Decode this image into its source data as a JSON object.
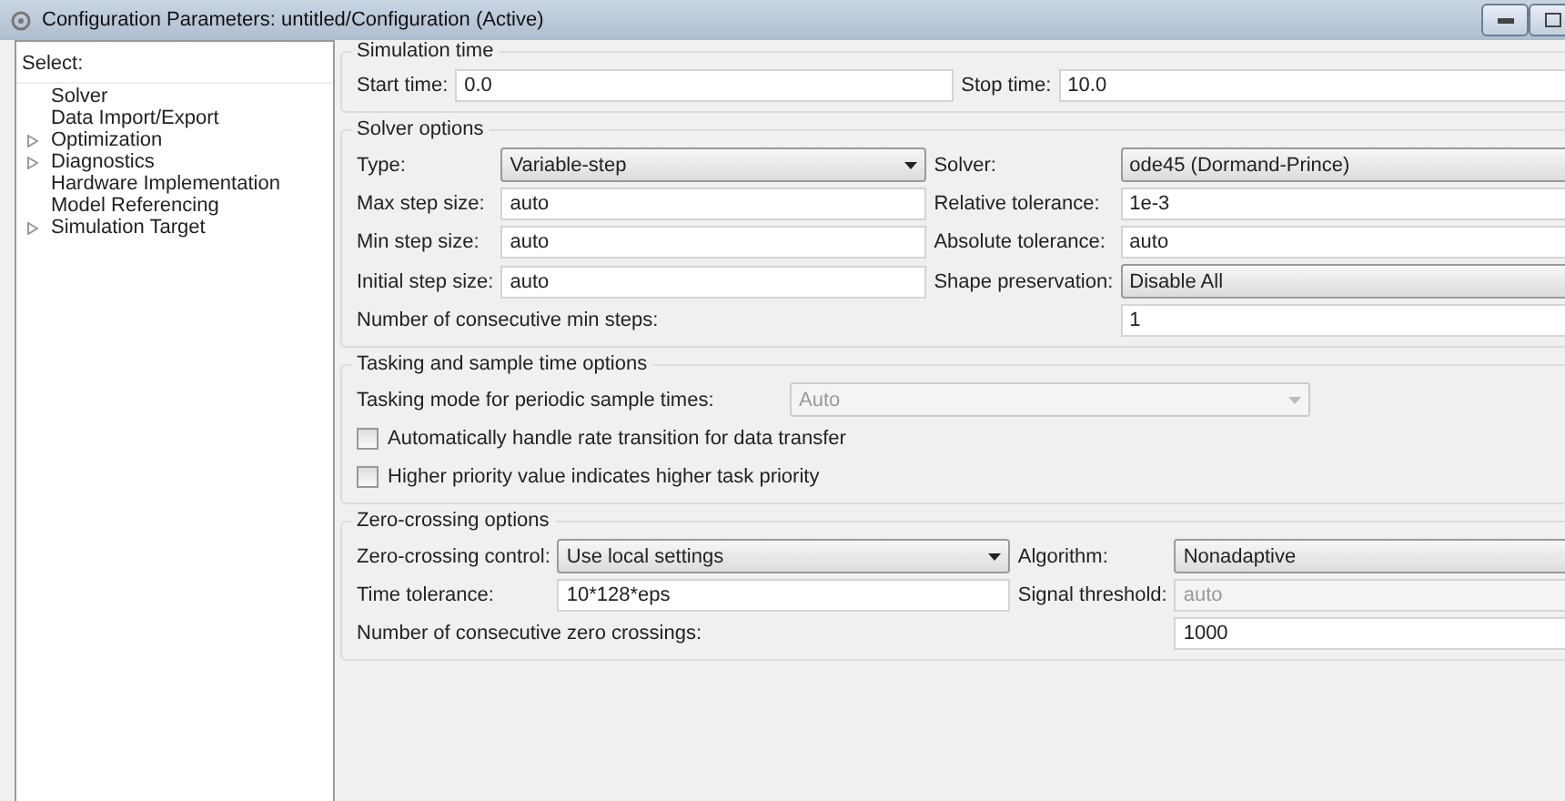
{
  "window": {
    "title": "Configuration Parameters: untitled/Configuration (Active)"
  },
  "sidebar": {
    "header": "Select:",
    "items": [
      {
        "label": "Solver",
        "kind": "leaf"
      },
      {
        "label": "Data Import/Export",
        "kind": "leaf"
      },
      {
        "label": "Optimization",
        "kind": "group",
        "expanded": false
      },
      {
        "label": "Diagnostics",
        "kind": "group",
        "expanded": false
      },
      {
        "label": "Hardware Implementation",
        "kind": "leaf"
      },
      {
        "label": "Model Referencing",
        "kind": "leaf"
      },
      {
        "label": "Simulation Target",
        "kind": "group",
        "expanded": false
      }
    ]
  },
  "sections": [
    {
      "title": "Simulation time",
      "kind": "time",
      "rows": [
        {
          "kind": "pair",
          "fields": [
            {
              "label": "Start time:",
              "kind": "text",
              "value": "0.0",
              "disabled": false
            },
            {
              "label": "Stop time:",
              "kind": "text",
              "value": "10.0",
              "disabled": false
            }
          ]
        }
      ]
    },
    {
      "title": "Solver options",
      "kind": "solver",
      "rows": [
        {
          "kind": "pair",
          "fields": [
            {
              "label": "Type:",
              "kind": "dropdown",
              "value": "Variable-step",
              "disabled": false
            },
            {
              "label": "Solver:",
              "kind": "dropdown",
              "value": "ode45 (Dormand-Prince)",
              "disabled": false
            }
          ]
        },
        {
          "kind": "pair",
          "fields": [
            {
              "label": "Max step size:",
              "kind": "text",
              "value": "auto",
              "disabled": false
            },
            {
              "label": "Relative tolerance:",
              "kind": "text",
              "value": "1e-3",
              "disabled": false
            }
          ]
        },
        {
          "kind": "pair",
          "fields": [
            {
              "label": "Min step size:",
              "kind": "text",
              "value": "auto",
              "disabled": false
            },
            {
              "label": "Absolute tolerance:",
              "kind": "text",
              "value": "auto",
              "disabled": false
            }
          ]
        },
        {
          "kind": "pair",
          "fields": [
            {
              "label": "Initial step size:",
              "kind": "text",
              "value": "auto",
              "disabled": false
            },
            {
              "label": "Shape preservation:",
              "kind": "dropdown",
              "value": "Disable All",
              "disabled": false
            }
          ]
        },
        {
          "kind": "single",
          "fields": [
            {
              "label": "Number of consecutive min steps:",
              "kind": "text",
              "value": "1",
              "disabled": false
            }
          ]
        }
      ]
    },
    {
      "title": "Tasking and sample time options",
      "kind": "tasking",
      "rows": [
        {
          "kind": "single",
          "fields": [
            {
              "label": "Tasking mode for periodic sample times:",
              "kind": "dropdown",
              "value": "Auto",
              "disabled": true
            }
          ]
        },
        {
          "kind": "checkbox",
          "label": "Automatically handle rate transition for data transfer",
          "checked": false
        },
        {
          "kind": "checkbox",
          "label": "Higher priority value indicates higher task priority",
          "checked": false
        }
      ]
    },
    {
      "title": "Zero-crossing options",
      "kind": "zero",
      "rows": [
        {
          "kind": "pair",
          "fields": [
            {
              "label": "Zero-crossing control:",
              "kind": "dropdown",
              "value": "Use local settings",
              "disabled": false
            },
            {
              "label": "Algorithm:",
              "kind": "dropdown",
              "value": "Nonadaptive",
              "disabled": false
            }
          ]
        },
        {
          "kind": "pair",
          "fields": [
            {
              "label": "Time tolerance:",
              "kind": "text",
              "value": "10*128*eps",
              "disabled": false
            },
            {
              "label": "Signal threshold:",
              "kind": "text",
              "value": "auto",
              "disabled": true
            }
          ]
        },
        {
          "kind": "single",
          "fields": [
            {
              "label": "Number of consecutive zero crossings:",
              "kind": "text",
              "value": "1000",
              "disabled": false
            }
          ]
        }
      ]
    }
  ]
}
